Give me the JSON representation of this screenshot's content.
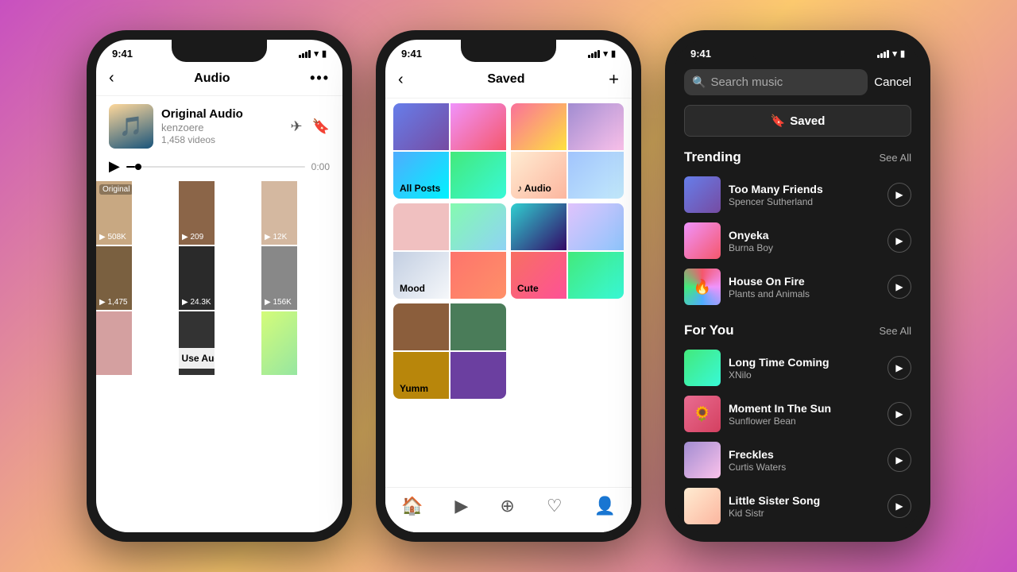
{
  "background": "gradient-purple-orange",
  "phones": {
    "phone1": {
      "status_time": "9:41",
      "header": {
        "back": "‹",
        "title": "Audio",
        "menu": "•••"
      },
      "audio": {
        "name": "Original Audio",
        "user": "kenzoere",
        "count": "1,458 videos",
        "time": "0:00",
        "use_audio_label": "Use Audio"
      },
      "videos": [
        {
          "label": "Original",
          "count": "508K"
        },
        {
          "count": "209"
        },
        {
          "count": "12K"
        },
        {
          "count": "1,475"
        },
        {
          "count": "24.3K"
        },
        {
          "count": "156K"
        },
        {
          "count": ""
        },
        {
          "count": ""
        },
        {
          "count": ""
        }
      ]
    },
    "phone2": {
      "status_time": "9:41",
      "header": {
        "back": "‹",
        "title": "Saved",
        "plus": "+"
      },
      "collections": [
        {
          "label": "All Posts"
        },
        {
          "label": "Audio",
          "is_audio": true
        },
        {
          "label": "Mood"
        },
        {
          "label": "Cute"
        },
        {
          "label": "Yumm"
        }
      ],
      "footer_icons": [
        "🏠",
        "▶",
        "+",
        "♡",
        "👤"
      ]
    },
    "phone3": {
      "status_time": "9:41",
      "search_placeholder": "Search music",
      "cancel_label": "Cancel",
      "saved_label": "Saved",
      "trending": {
        "title": "Trending",
        "see_all": "See All",
        "items": [
          {
            "title": "Too Many Friends",
            "artist": "Spencer Sutherland"
          },
          {
            "title": "Onyeka",
            "artist": "Burna Boy"
          },
          {
            "title": "House On Fire",
            "artist": "Plants and Animals"
          }
        ]
      },
      "for_you": {
        "title": "For You",
        "see_all": "See All",
        "items": [
          {
            "title": "Long Time Coming",
            "artist": "XNilo"
          },
          {
            "title": "Moment In The Sun",
            "artist": "Sunflower Bean"
          },
          {
            "title": "Freckles",
            "artist": "Curtis Waters"
          },
          {
            "title": "Little Sister Song",
            "artist": "Kid Sistr"
          }
        ]
      }
    }
  }
}
